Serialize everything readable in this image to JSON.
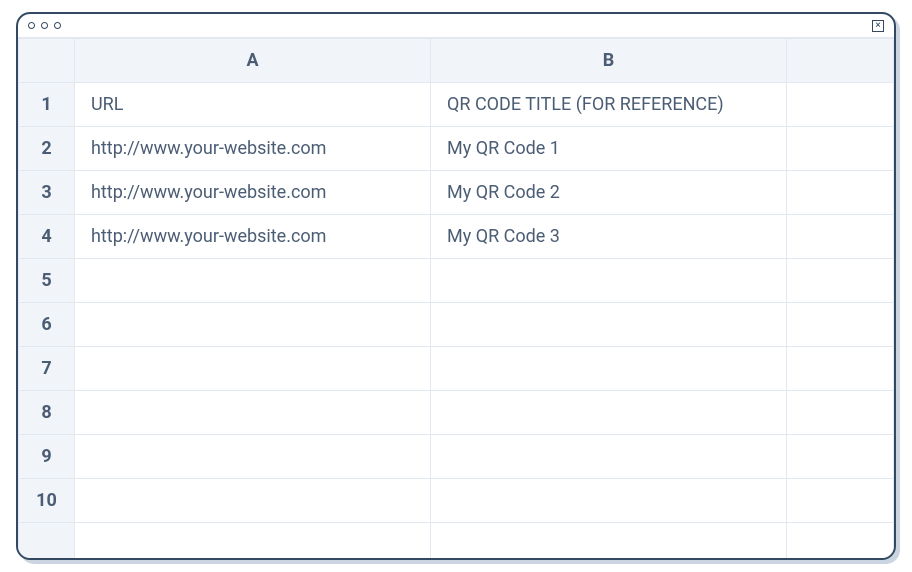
{
  "window": {
    "traffic_lights": [
      "",
      "",
      ""
    ],
    "close_label": "×"
  },
  "spreadsheet": {
    "corner": "",
    "columns": [
      "A",
      "B",
      ""
    ],
    "rows": [
      {
        "num": "1",
        "cells": [
          "URL",
          "QR CODE TITLE (FOR REFERENCE)",
          ""
        ]
      },
      {
        "num": "2",
        "cells": [
          "http://www.your-website.com",
          "My QR Code 1",
          ""
        ]
      },
      {
        "num": "3",
        "cells": [
          "http://www.your-website.com",
          "My QR Code 2",
          ""
        ]
      },
      {
        "num": "4",
        "cells": [
          "http://www.your-website.com",
          "My QR Code 3",
          ""
        ]
      },
      {
        "num": "5",
        "cells": [
          "",
          "",
          ""
        ]
      },
      {
        "num": "6",
        "cells": [
          "",
          "",
          ""
        ]
      },
      {
        "num": "7",
        "cells": [
          "",
          "",
          ""
        ]
      },
      {
        "num": "8",
        "cells": [
          "",
          "",
          ""
        ]
      },
      {
        "num": "9",
        "cells": [
          "",
          "",
          ""
        ]
      },
      {
        "num": "10",
        "cells": [
          "",
          "",
          ""
        ]
      },
      {
        "num": "",
        "cells": [
          "",
          "",
          ""
        ]
      }
    ]
  }
}
